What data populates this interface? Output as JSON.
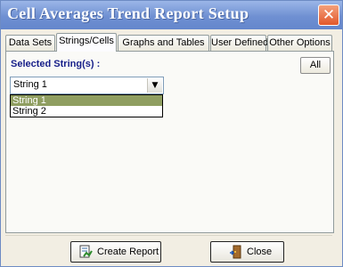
{
  "window": {
    "title": "Cell Averages Trend Report Setup",
    "close_glyph": "✕"
  },
  "tabs": [
    {
      "label": "Data Sets"
    },
    {
      "label": "Strings/Cells"
    },
    {
      "label": "Graphs and Tables"
    },
    {
      "label": "User Defined"
    },
    {
      "label": "Other Options"
    }
  ],
  "panel": {
    "selected_label": "Selected String(s) :",
    "all_button": "All",
    "combo": {
      "value": "String 1",
      "arrow": "▼"
    },
    "options": [
      {
        "label": "String 1",
        "selected": true
      },
      {
        "label": "String 2",
        "selected": false
      }
    ]
  },
  "buttons": {
    "create_report": "Create Report",
    "close": "Close",
    "create_icon": "report-icon",
    "close_icon": "exit-door-icon"
  },
  "colors": {
    "title_bar": "#6f90d2",
    "label_blue": "#18208a",
    "selected_option": "#8f9e61",
    "close_button": "#e2582b"
  }
}
